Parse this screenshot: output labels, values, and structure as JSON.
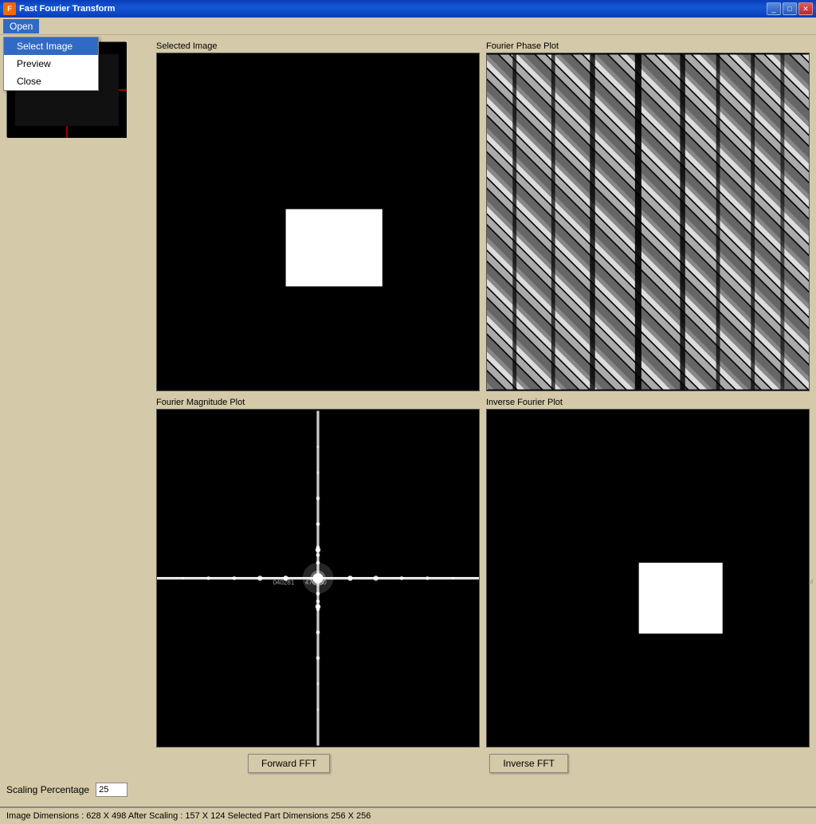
{
  "titleBar": {
    "title": "Fast Fourier Transform",
    "icon": "FFT",
    "minimizeLabel": "_",
    "maximizeLabel": "□",
    "closeLabel": "✕"
  },
  "menuBar": {
    "openLabel": "Open"
  },
  "dropdownMenu": {
    "items": [
      {
        "label": "Select Image",
        "id": "select-image"
      },
      {
        "label": "Preview",
        "id": "preview"
      },
      {
        "label": "Close",
        "id": "close"
      }
    ]
  },
  "panels": {
    "selectedImage": {
      "title": "Selected Image"
    },
    "fourierPhase": {
      "title": "Fourier Phase Plot"
    },
    "fourierMagnitude": {
      "title": "Fourier Magnitude Plot"
    },
    "inverseFourier": {
      "title": "Inverse Fourier  Plot"
    }
  },
  "buttons": {
    "forwardFFT": "Forward FFT",
    "inverseFFT": "Inverse FFT"
  },
  "scaling": {
    "label": "Scaling Percentage",
    "value": "25"
  },
  "statusBar": {
    "text": "Image Dimensions :  628 X 498  After Scaling :  157 X 124  Selected Part Dimensions  256 X 256"
  }
}
